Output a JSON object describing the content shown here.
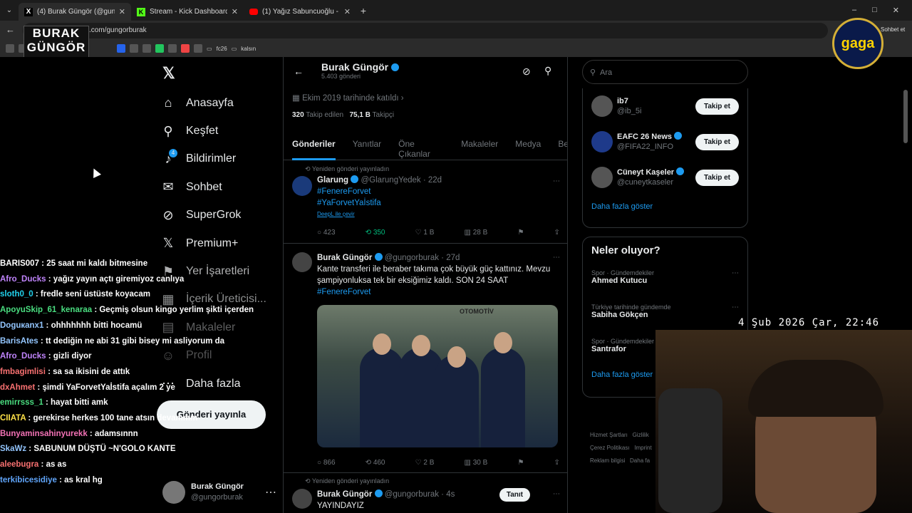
{
  "browser": {
    "tabs": [
      {
        "label": "(4) Burak Güngör (@gungorburak)",
        "icon": "x-logo"
      },
      {
        "label": "Stream - Kick Dashboard",
        "icon": "kick-logo"
      },
      {
        "label": "(1) Yağız Sabuncuoğlu - YouTube",
        "icon": "youtube-logo"
      }
    ],
    "url": "x.com/gungorburak",
    "bookmarks": [
      "fc26",
      "kalsın"
    ],
    "sohbet_label": "Sohbet et"
  },
  "overlay": {
    "logo_line1": "BURAK",
    "logo_line2": "GÜNGÖR",
    "gaga": "gaga",
    "clock": "4 Şub 2026 Çar, 22:46"
  },
  "nav": {
    "items": [
      "Anasayfa",
      "Keşfet",
      "Bildirimler",
      "Sohbet",
      "SuperGrok",
      "Premium+",
      "Yer İşaretleri",
      "İçerik Üreticisi...",
      "Makaleler",
      "Profil",
      "Daha fazla"
    ],
    "notif_badge": "4",
    "post_button": "Gönderi yayınla",
    "account": {
      "name": "Burak Güngör",
      "handle": "@gungorburak"
    }
  },
  "profile": {
    "name": "Burak Güngör",
    "posts": "5.403 gönderi",
    "joined": "Ekim 2019 tarihinde katıldı",
    "following_count": "320",
    "following_label": "Takip edilen",
    "followers_count": "75,1 B",
    "followers_label": "Takipçi"
  },
  "tabs": [
    "Gönderiler",
    "Yanıtlar",
    "Öne Çıkanlar",
    "Makaleler",
    "Medya",
    "Be"
  ],
  "tweets": [
    {
      "repost_label": "Yeniden gönderi yayınladın",
      "name": "Glarung",
      "handle": "@GlarungYedek · 22d",
      "text1": "#FenereForvet",
      "text2": "#YaForvetYaİstifa",
      "translate": "DeepL ile çevir",
      "replies": "423",
      "reposts": "350",
      "likes": "1 B",
      "views": "28 B"
    },
    {
      "name": "Burak Güngör",
      "handle": "@gungorburak · 27d",
      "text1": "Kante transferi ile beraber takıma çok büyük güç kattınız. Mevzu şampiyonluksa tek bir eksiğimiz kaldı. SON 24 SAAT",
      "text2": "#FenereForvet",
      "image_sign": "OTOMOTİV",
      "replies": "866",
      "reposts": "460",
      "likes": "2 B",
      "views": "30 B"
    },
    {
      "repost_label": "Yeniden gönderi yayınladın",
      "name": "Burak Güngör",
      "handle": "@gungorburak · 4s",
      "text1": "YAYINDAYIZ",
      "tanit": "Tanıt"
    }
  ],
  "right": {
    "search_placeholder": "Ara",
    "follows": [
      {
        "name": "ib7",
        "handle": "@ib_5i",
        "btn": "Takip et"
      },
      {
        "name": "EAFC 26 News",
        "handle": "@FIFA22_INFO",
        "btn": "Takip et"
      },
      {
        "name": "Cüneyt Kaşeler",
        "handle": "@cuneytkaseler",
        "btn": "Takip et"
      }
    ],
    "show_more": "Daha fazla göster",
    "trends_title": "Neler oluyor?",
    "trends": [
      {
        "cat": "Spor · Gündemdekiler",
        "title": "Ahmed Kutucu"
      },
      {
        "cat": "Türkiye tarihinde gündemde",
        "title": "Sabiha Gökçen"
      },
      {
        "cat": "Spor · Gündemdekiler",
        "title": "Santrafor"
      }
    ],
    "show_more2": "Daha fazla göster",
    "footer": [
      "Hizmet Şartları",
      "Gizlilik",
      "Çerez Politikası",
      "Imprint",
      "Reklam bilgisi",
      "Daha fa"
    ]
  },
  "chat": [
    {
      "user": "BARIS007",
      "msg": "25 saat mi kaldı bitmesine",
      "color": "#ffffff"
    },
    {
      "user": "Afro_Ducks",
      "msg": "yağız yayın açtı giremiyoz canlıya",
      "color": "#c084fc"
    },
    {
      "user": "sloth0_0",
      "msg": "fredle seni üstüste koyacam",
      "color": "#22d3ee"
    },
    {
      "user": "ApoyuSkip_61_kenaraa",
      "msg": "Geçmiş olsun kingo yerlim şikti içerden",
      "color": "#4ade80"
    },
    {
      "user": "Doguкanx1",
      "msg": "ohhhhhhh bitti hocamü",
      "color": "#93c5fd"
    },
    {
      "user": "BarisAtes",
      "msg": "tt dediğin ne abi 31 gibi bisey mi asliyorum da",
      "color": "#93c5fd"
    },
    {
      "user": "Afro_Ducks",
      "msg": "gizli diyor",
      "color": "#c084fc"
    },
    {
      "user": "fmbagimlisi",
      "msg": "sa sa ikisini de attık",
      "color": "#f87171"
    },
    {
      "user": "dxAhmet",
      "msg": "şimdi YaForvetYaİstifa açalım 2 ye",
      "color": "#f87171"
    },
    {
      "user": "emirrsss_1",
      "msg": "hayat bitti amk",
      "color": "#4ade80"
    },
    {
      "user": "CIIATA",
      "msg": "gerekirse herkes 100 tane atsın devammm",
      "color": "#fde047"
    },
    {
      "user": "Bunyaminsahinyurekk",
      "msg": "adamsınnn",
      "color": "#f472b6"
    },
    {
      "user": "SkaWz",
      "msg": "SABUNUM DÜŞTÜ ~N'GOLO KANTE",
      "color": "#93c5fd"
    },
    {
      "user": "aleebugra",
      "msg": "as as",
      "color": "#f87171"
    },
    {
      "user": "terkibicesidiye",
      "msg": "as kral hg",
      "color": "#60a5fa"
    }
  ]
}
